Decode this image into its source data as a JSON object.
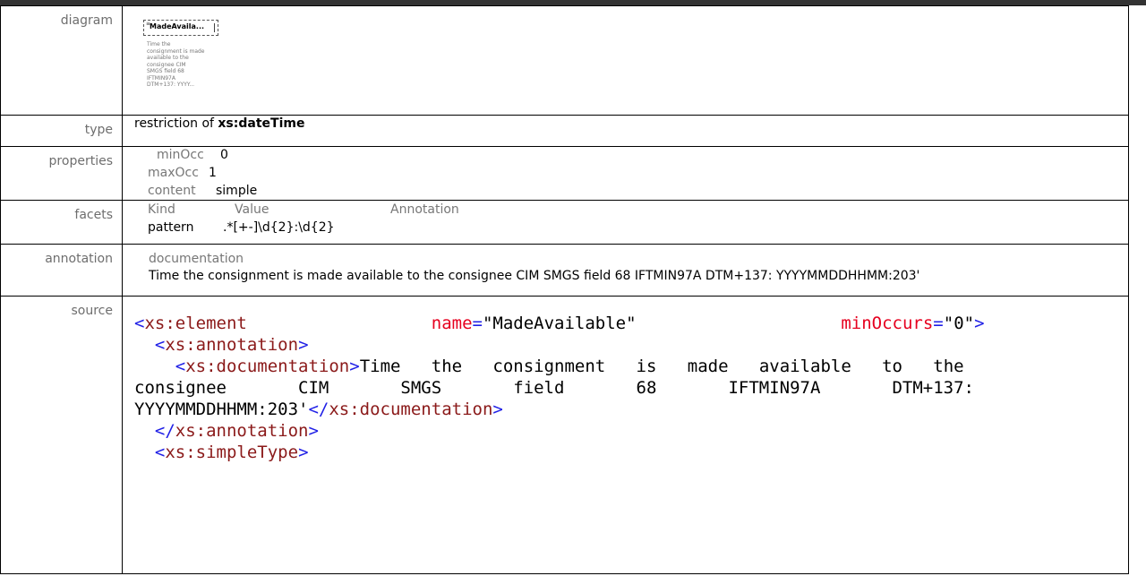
{
  "labels": {
    "diagram": "diagram",
    "type": "type",
    "properties": "properties",
    "facets": "facets",
    "annotation": "annotation",
    "source": "source"
  },
  "diagram": {
    "node_name": "MadeAvaila...",
    "node_doc_lines": [
      "Time the",
      "consignment is made",
      "available to the",
      "consignee CIM",
      "SMGS field 68",
      "IFTMIN97A",
      "DTM+137: YYYY..."
    ]
  },
  "type": {
    "prefix": "restriction of ",
    "base": "xs:dateTime"
  },
  "properties": [
    {
      "key": "minOcc",
      "value": "0"
    },
    {
      "key": "maxOcc",
      "value": "1"
    },
    {
      "key": "content",
      "value": "simple"
    }
  ],
  "facets": {
    "headers": [
      "Kind",
      "Value",
      "Annotation"
    ],
    "rows": [
      {
        "kind": "pattern",
        "value": ".*[+-]\\d{2}:\\d{2}",
        "annotation": ""
      }
    ]
  },
  "annotation": {
    "header": "documentation",
    "text": "Time the consignment is made available to the consignee CIM SMGS field 68 IFTMIN97A DTM+137: YYYYMMDDHHMM:203'"
  },
  "source": {
    "line1_tag": "xs:element",
    "line1_attr1_name": "name",
    "line1_attr1_value": "\"MadeAvailable\"",
    "line1_attr2_name": "minOccurs",
    "line1_attr2_value": "\"0\"",
    "line2_tag": "xs:annotation",
    "line3_tag": "xs:documentation",
    "line3_text_a": "Time   the   consignment   is   made   available   to   the",
    "line4_text": "consignee       CIM       SMGS       field       68       IFTMIN97A       DTM+137:",
    "line5_text": "YYYYMMDDHHMM:203'",
    "line5_close_tag": "xs:documentation",
    "line6_close_tag": "xs:annotation",
    "line7_tag": "xs:simpleType"
  }
}
